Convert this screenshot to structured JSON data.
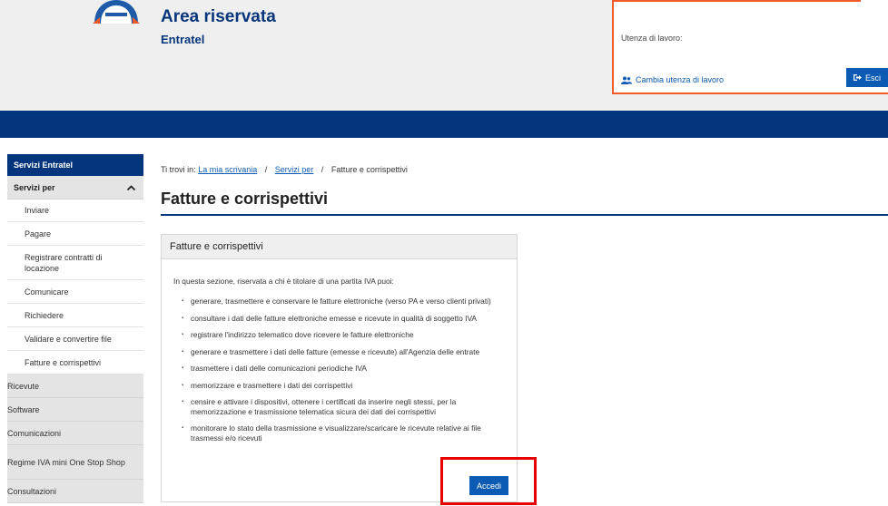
{
  "header": {
    "title": "Area riservata",
    "subtitle": "Entratel",
    "utenza_label": "Utenza di lavoro:",
    "cambia_label": "Cambia utenza di lavoro",
    "esci_label": "Esci",
    "colors": {
      "brand": "#06357a",
      "accent": "#f25a29",
      "button": "#0b5ab3"
    }
  },
  "sidebar": {
    "head": "Servizi Entratel",
    "group": "Servizi per",
    "sub_items": [
      {
        "label": "Inviare"
      },
      {
        "label": "Pagare"
      },
      {
        "label": "Registrare contratti di locazione"
      },
      {
        "label": "Comunicare"
      },
      {
        "label": "Richiedere"
      },
      {
        "label": "Validare e convertire file"
      },
      {
        "label": "Fatture e corrispettivi"
      }
    ],
    "items": [
      {
        "label": "Ricevute"
      },
      {
        "label": "Software"
      },
      {
        "label": "Comunicazioni"
      },
      {
        "label": "Regime IVA mini One Stop Shop"
      },
      {
        "label": "Consultazioni"
      }
    ]
  },
  "breadcrumb": {
    "prefix": "Ti trovi in:",
    "link1": "La mia scrivania",
    "link2": "Servizi per",
    "current": "Fatture e corrispettivi",
    "separator": "/"
  },
  "main": {
    "title": "Fatture e corrispettivi",
    "card": {
      "title": "Fatture e corrispettivi",
      "intro": "In questa sezione, riservata a chi è titolare di una partita IVA puoi:",
      "items": [
        "generare, trasmettere e conservare le fatture elettroniche (verso PA e verso clienti privati)",
        "consultare i dati delle fatture elettroniche emesse e ricevute in qualità di soggetto IVA",
        "registrare l'indirizzo telematico dove ricevere le fatture elettroniche",
        "generare e trasmettere i dati delle fatture (emesse e ricevute) all'Agenzia delle entrate",
        "trasmettere i dati delle comunicazioni periodiche IVA",
        "memorizzare e trasmettere i dati dei corrispettivi",
        "censire e attivare i dispositivi, ottenere i certificati da inserire negli stessi, per la memorizzazione e trasmissione telematica sicura dei dati dei corrispettivi",
        "monitorare lo stato della trasmissione e visualizzare/scaricare le ricevute relative ai file trasmessi e/o ricevuti"
      ],
      "button": "Accedi"
    }
  }
}
